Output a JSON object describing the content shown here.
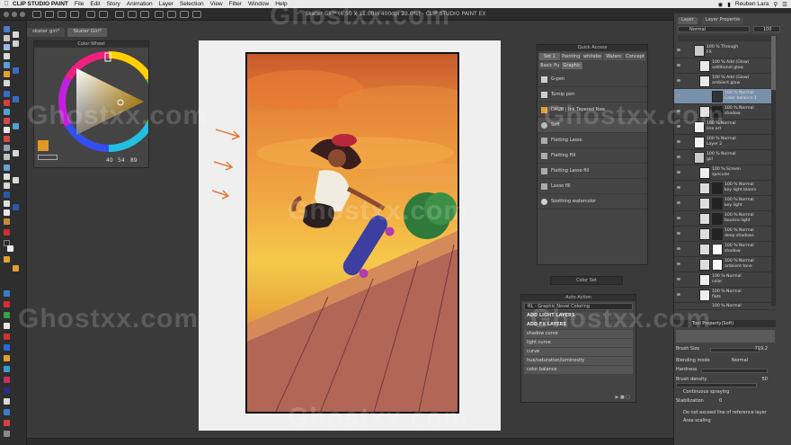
{
  "menubar": {
    "app": "CLIP STUDIO PAINT",
    "items": [
      "File",
      "Edit",
      "Story",
      "Animation",
      "Layer",
      "Selection",
      "View",
      "Filter",
      "Window",
      "Help"
    ],
    "user": "Reuben Lara"
  },
  "window": {
    "title": "Skater Girl* (6.50 x 11.00in 400dpi 23.0%)  - CLIP STUDIO PAINT EX"
  },
  "tabs": [
    "skater girl*",
    "Skater Girl*"
  ],
  "color_wheel": {
    "title": "Color Wheel",
    "values": [
      "40",
      "54",
      "89"
    ]
  },
  "quick_access": {
    "title": "Quick Access",
    "set_tabs": [
      "Set 1",
      "Painting",
      "whitebo",
      "Waterc",
      "Concept"
    ],
    "sub_tabs": [
      "Basic Pu",
      "Graphic"
    ],
    "items": [
      "G-pen",
      "Turnip pen",
      "DAUB | Ink Tapered Raw",
      "Soft",
      "Flatting Lasso",
      "Flatting Fill",
      "Flatting Lasso fill",
      "Lasso fill",
      "Soothing watercolor"
    ]
  },
  "color_set": {
    "title": "Color Set"
  },
  "auto_action": {
    "title": "Auto Action",
    "selected": "RL - Graphic Novel Coloring",
    "rows": [
      "ADD LIGHT LAYERS",
      "ADD FX LAYERS",
      "shadow curve",
      "light curve",
      "curve",
      "hue/saturation/luminosity",
      "color balance"
    ]
  },
  "layers": {
    "tabs": [
      "Layer",
      "Layer Propertie"
    ],
    "blend": "Normal",
    "opacity": "100",
    "items": [
      {
        "line1": "100 % Through",
        "line2": "FX"
      },
      {
        "line1": "100 % Add (Glow)",
        "line2": "additional glow"
      },
      {
        "line1": "100 % Add (Glow)",
        "line2": "ambient glow"
      },
      {
        "line1": "100 % Normal",
        "line2": "Color balance 1"
      },
      {
        "line1": "100 % Normal",
        "line2": "shadow"
      },
      {
        "line1": "100 % Normal",
        "line2": "line art"
      },
      {
        "line1": "100 % Normal",
        "line2": "Layer 2"
      },
      {
        "line1": "100 % Normal",
        "line2": "girl"
      },
      {
        "line1": "100 % Screen",
        "line2": "specular"
      },
      {
        "line1": "100 % Normal",
        "line2": "key light bloom"
      },
      {
        "line1": "100 % Normal",
        "line2": "key light"
      },
      {
        "line1": "100 % Normal",
        "line2": "bounce light"
      },
      {
        "line1": "100 % Normal",
        "line2": "deep shadows"
      },
      {
        "line1": "100 % Normal",
        "line2": "shadow"
      },
      {
        "line1": "100 % Normal",
        "line2": "ambient tone"
      },
      {
        "line1": "100 % Normal",
        "line2": "color"
      },
      {
        "line1": "100 % Normal",
        "line2": "flats"
      },
      {
        "line1": "100 % Normal",
        "line2": ""
      }
    ]
  },
  "tool_property": {
    "title": "Tool Property(Soft)",
    "brush_size": "Brush Size",
    "brush_size_value": "719.2",
    "blending_mode": "Blending mode",
    "blending_mode_value": "Normal",
    "hardness": "Hardness",
    "brush_density": "Brush density",
    "brush_density_value": "50",
    "continuous": "Continuous spraying",
    "stabilization": "Stabilization",
    "stabilization_value": "0",
    "ref_line": "Do not exceed line of reference layer",
    "area_scaling": "Area scaling"
  },
  "watermark": "Ghostxx.com",
  "colors": {
    "accent_orange": "#e09a22",
    "selected_layer": "#7a8fa9"
  }
}
